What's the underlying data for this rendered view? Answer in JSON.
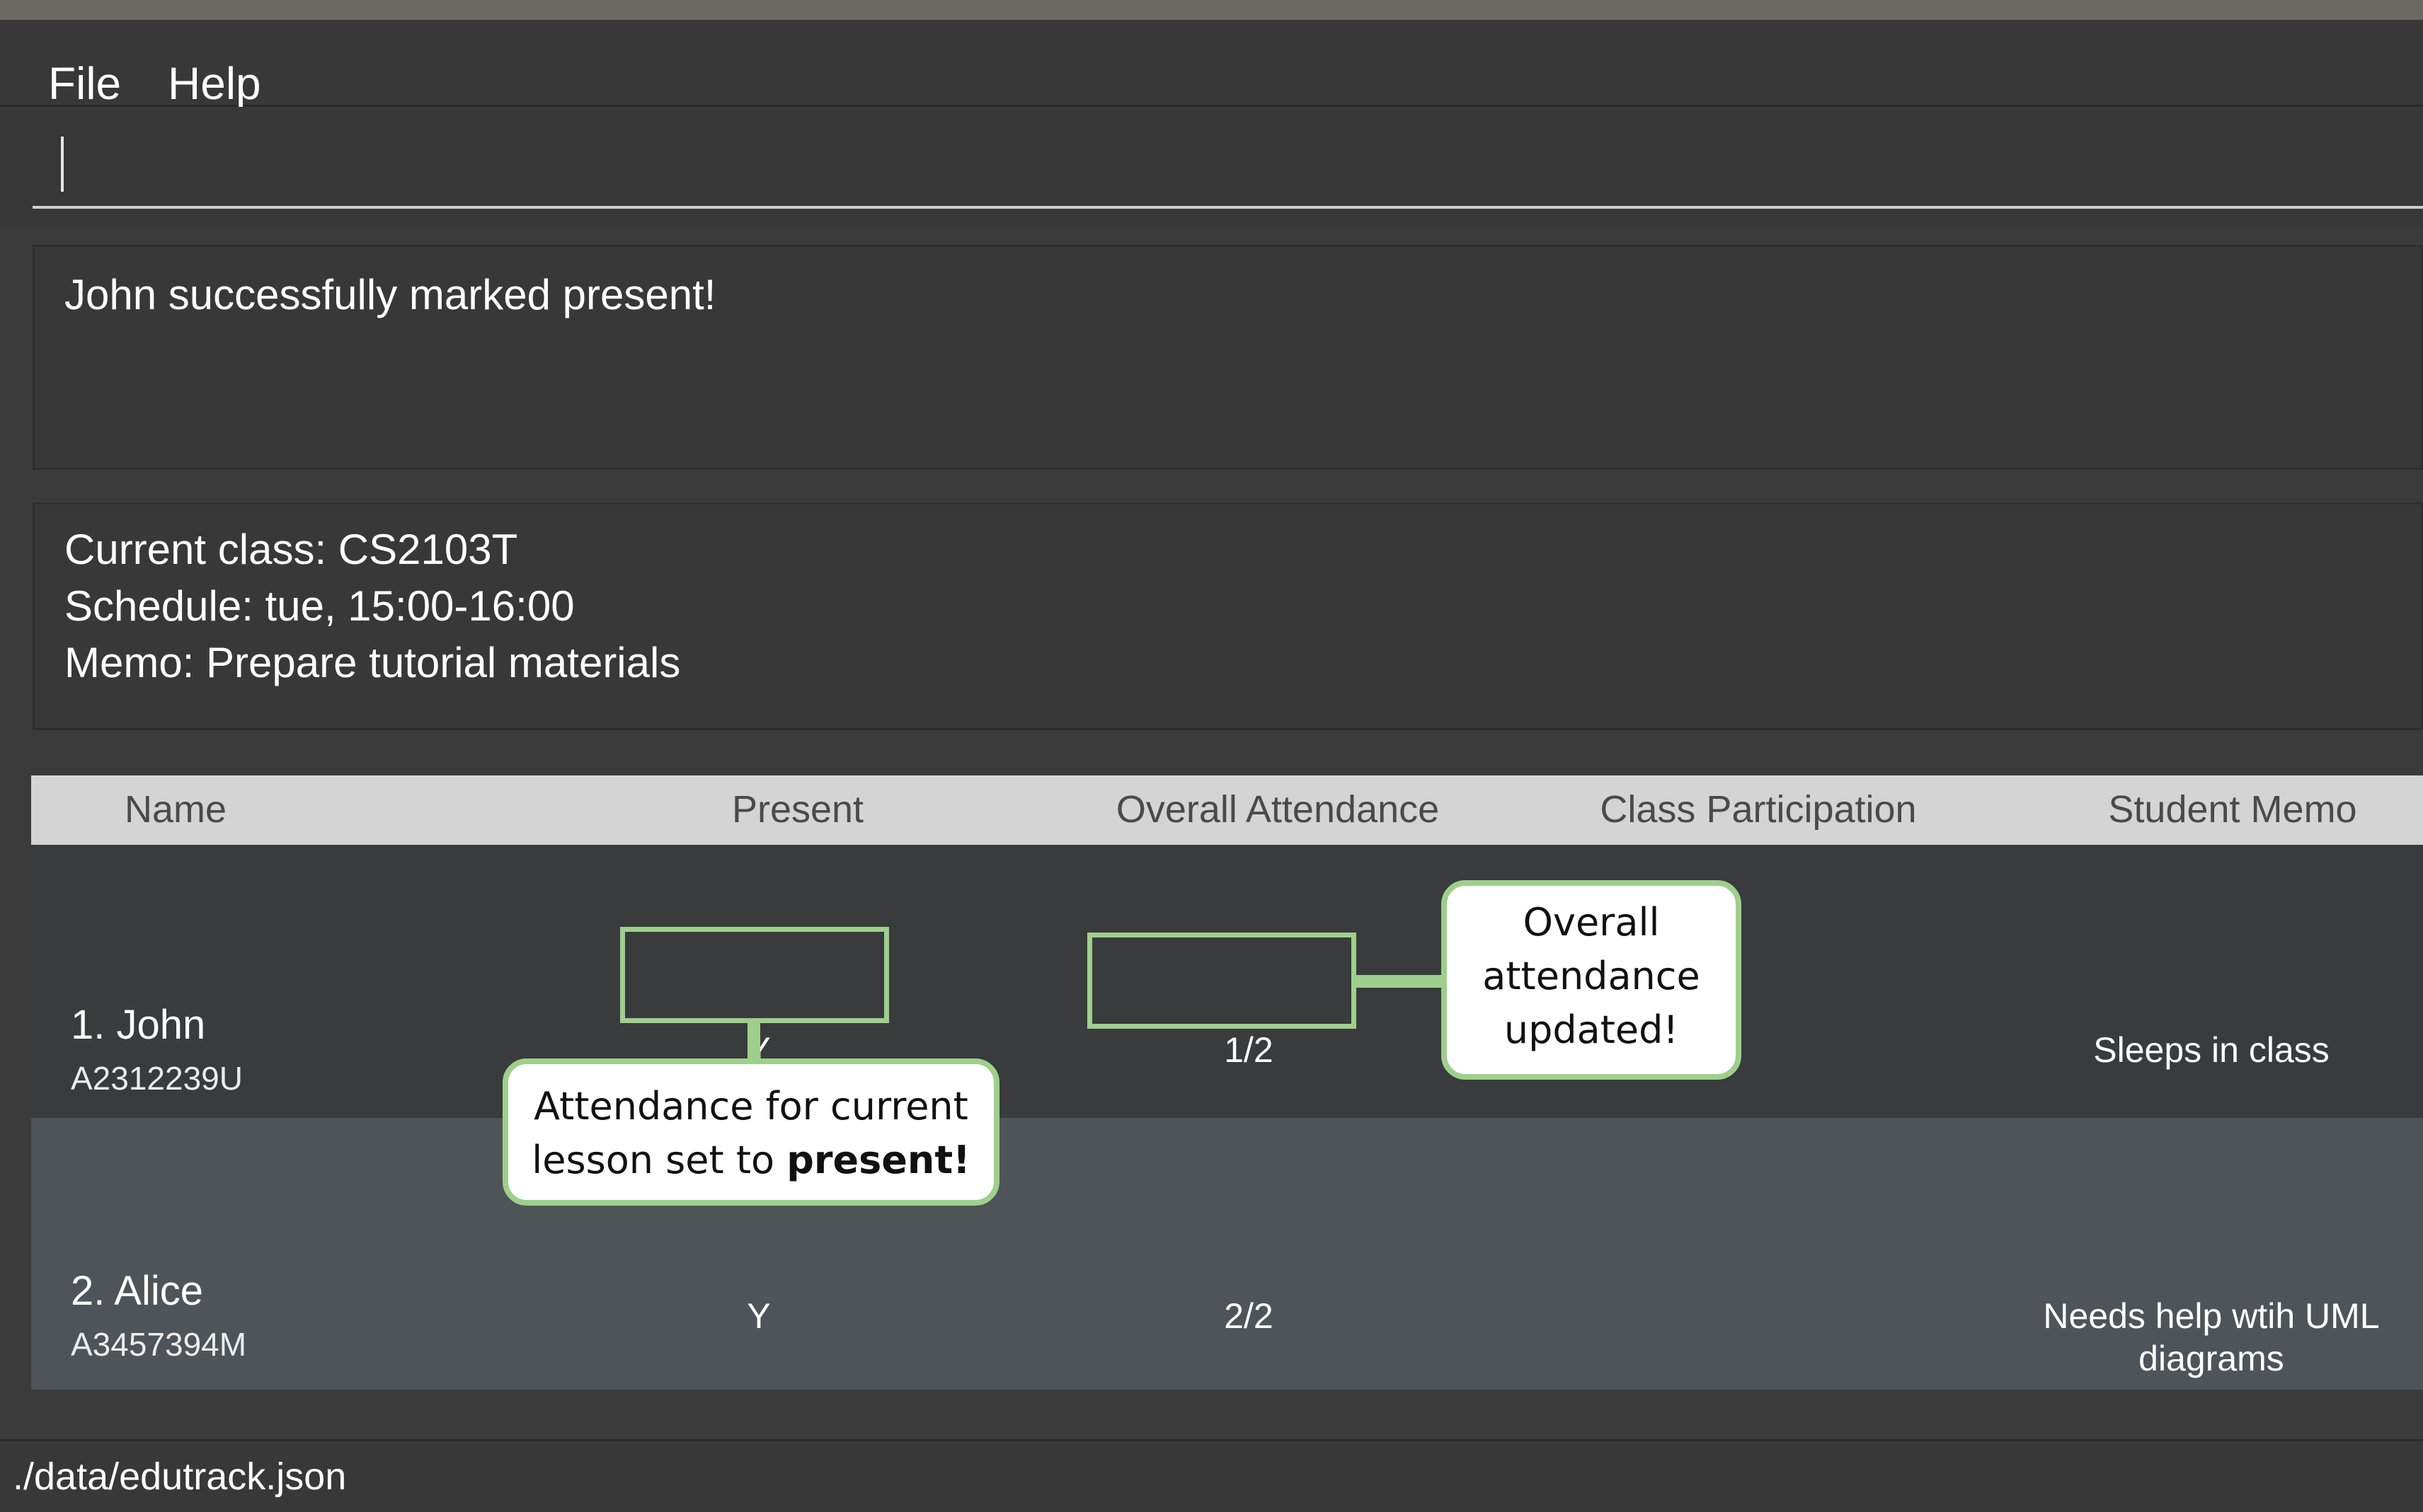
{
  "menu": {
    "file_label": "File",
    "help_label": "Help"
  },
  "command_box": {
    "value": ""
  },
  "result_display": {
    "message": "John successfully marked present!"
  },
  "class_info": {
    "current_class": "Current class: CS2103T",
    "schedule": "Schedule: tue, 15:00-16:00",
    "memo": "Memo: Prepare tutorial materials"
  },
  "table": {
    "headers": [
      "Name",
      "Present",
      "Overall Attendance",
      "Class Participation",
      "Student Memo"
    ],
    "rows": [
      {
        "name": "1.  John",
        "id": "A2312239U",
        "present": "Y",
        "overall_attendance": "1/2",
        "class_participation": "",
        "memo": "Sleeps in class"
      },
      {
        "name": "2.  Alice",
        "id": "A3457394M",
        "present": "Y",
        "overall_attendance": "2/2",
        "class_participation": "",
        "memo": "Needs help wtih UML diagrams"
      }
    ]
  },
  "annotations": {
    "present_callout_line1": "Attendance for current",
    "present_callout_line2_prefix": "lesson set to ",
    "present_callout_line2_bold": "present!",
    "overall_callout_line1": "Overall",
    "overall_callout_line2": "attendance",
    "overall_callout_line3": "updated!",
    "accent_color": "#9fcf8c"
  },
  "status_bar": {
    "path": "./data/edutrack.json"
  }
}
